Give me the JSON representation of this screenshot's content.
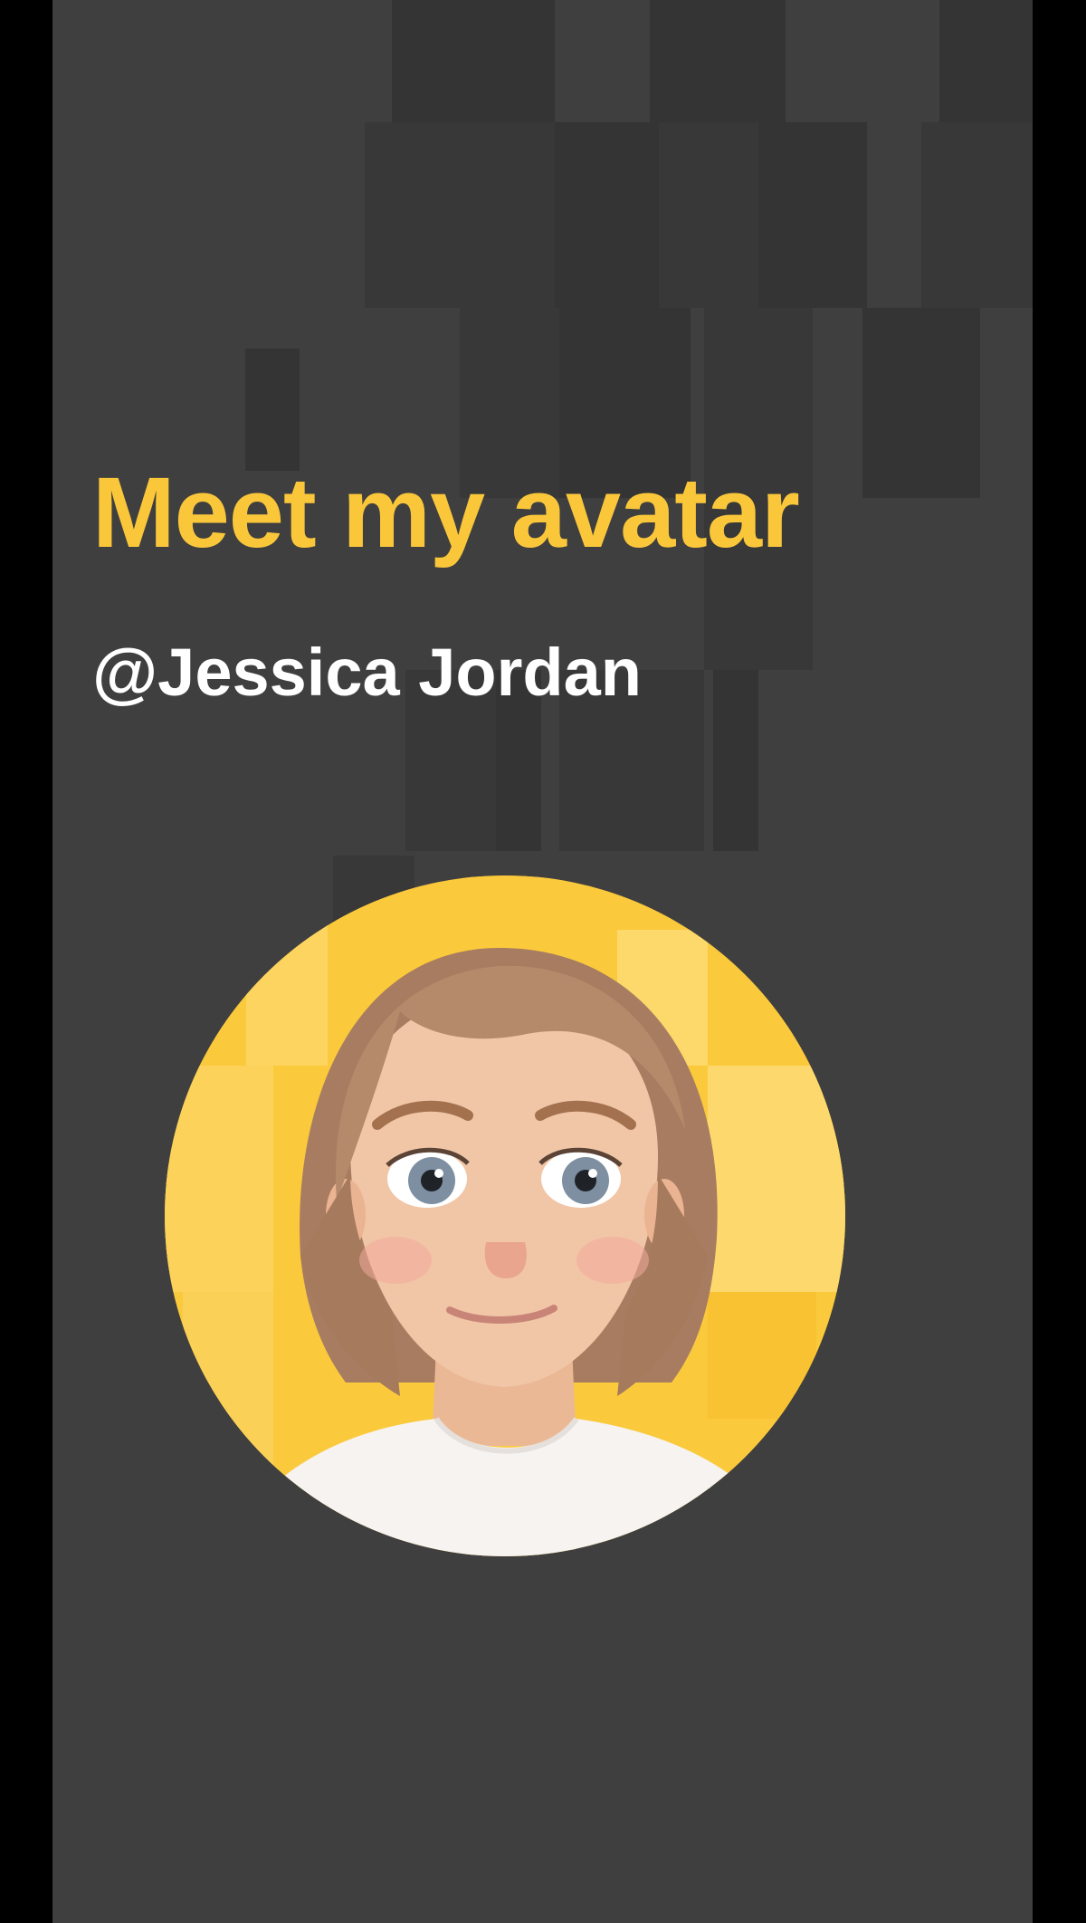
{
  "app": {
    "title": "Meet my avatar",
    "handle": "@Jessica Jordan"
  },
  "avatar": {
    "icon": "avatar-portrait-icon",
    "description_colors": {
      "background": "#fbc93c",
      "hair": "#b08466",
      "skin": "#f0c3a2",
      "shirt": "#f7f4f2"
    }
  },
  "colors": {
    "page_background": "#3f3f3f",
    "accent": "#fbc73a",
    "text_primary": "#ffffff",
    "letterbox": "#000000"
  }
}
